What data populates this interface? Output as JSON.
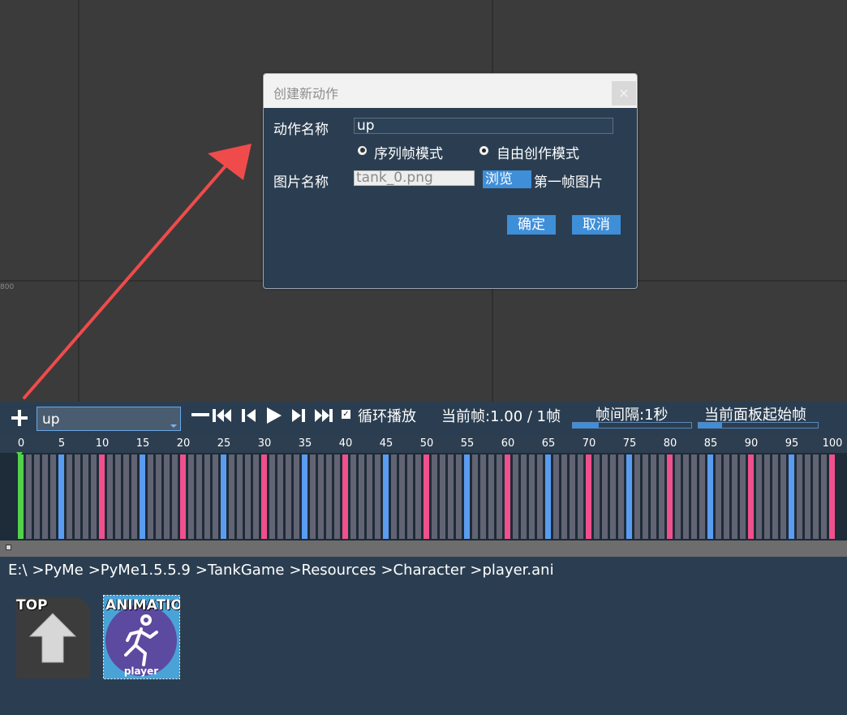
{
  "canvas": {
    "ruler_value": "800"
  },
  "dialog": {
    "title": "创建新动作",
    "close_label": "×",
    "action_name_label": "动作名称",
    "action_name_value": "up",
    "mode_options": [
      {
        "label": "序列帧模式",
        "selected": false
      },
      {
        "label": "自由创作模式",
        "selected": true
      }
    ],
    "image_name_label": "图片名称",
    "image_name_value": "tank_0.png",
    "browse_label": "浏览",
    "first_frame_label": "第一帧图片",
    "ok_label": "确定",
    "cancel_label": "取消"
  },
  "toolbar": {
    "add_label": "+",
    "action_select_value": "up",
    "loop_checked": true,
    "loop_label": "循环播放",
    "current_frame": "当前帧:1.00 / 1帧",
    "frame_interval": "帧间隔:1秒",
    "frame_interval_fill": 0.22,
    "panel_start": "当前面板起始帧",
    "panel_start_fill": 0.2
  },
  "timeline": {
    "tick_labels": [
      "0",
      "5",
      "10",
      "15",
      "20",
      "25",
      "30",
      "35",
      "40",
      "45",
      "50",
      "55",
      "60",
      "65",
      "70",
      "75",
      "80",
      "85",
      "90",
      "95",
      "100"
    ],
    "frame_count": 101,
    "colors": {
      "keyframe": "#52d14a",
      "default": "#626473",
      "pink": "#f0508c",
      "blue": "#5a9cf0"
    }
  },
  "explorer": {
    "breadcrumbs": [
      "E:\\",
      ">PyMe",
      ">PyMe1.5.5.9",
      ">TankGame",
      ">Resources",
      ">Character",
      ">player.ani"
    ],
    "tiles": [
      {
        "label": "TOP",
        "icon": "up-arrow-icon"
      },
      {
        "label": "ANIMATIO",
        "sublabel": "player",
        "icon": "running-man-icon"
      }
    ]
  }
}
